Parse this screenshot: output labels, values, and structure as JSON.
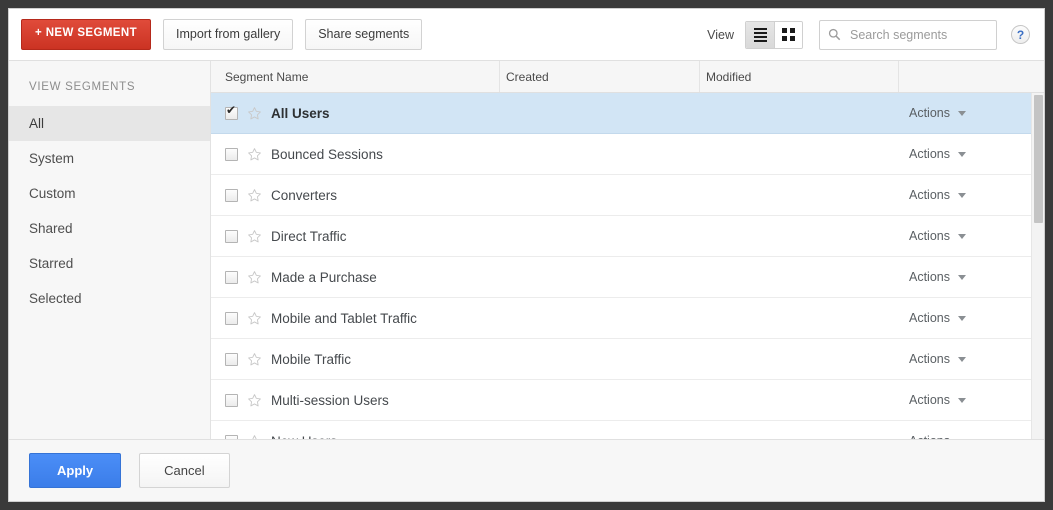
{
  "toolbar": {
    "new_segment_label": "+ NEW SEGMENT",
    "import_label": "Import from gallery",
    "share_label": "Share segments",
    "view_label": "View",
    "list_view_icon": "list-view-icon",
    "grid_view_icon": "grid-view-icon",
    "search_placeholder": "Search segments",
    "search_value": "",
    "search_icon": "search-icon",
    "help_icon": "help-icon",
    "help_glyph": "?"
  },
  "sidebar": {
    "heading": "VIEW SEGMENTS",
    "items": [
      {
        "label": "All",
        "active": true
      },
      {
        "label": "System",
        "active": false
      },
      {
        "label": "Custom",
        "active": false
      },
      {
        "label": "Shared",
        "active": false
      },
      {
        "label": "Starred",
        "active": false
      },
      {
        "label": "Selected",
        "active": false
      }
    ]
  },
  "table": {
    "columns": [
      "Segment Name",
      "Created",
      "Modified",
      ""
    ],
    "action_label": "Actions",
    "rows": [
      {
        "name": "All Users",
        "created": "",
        "modified": "",
        "checked": true,
        "starred": false,
        "selected": true
      },
      {
        "name": "Bounced Sessions",
        "created": "",
        "modified": "",
        "checked": false,
        "starred": false,
        "selected": false
      },
      {
        "name": "Converters",
        "created": "",
        "modified": "",
        "checked": false,
        "starred": false,
        "selected": false
      },
      {
        "name": "Direct Traffic",
        "created": "",
        "modified": "",
        "checked": false,
        "starred": false,
        "selected": false
      },
      {
        "name": "Made a Purchase",
        "created": "",
        "modified": "",
        "checked": false,
        "starred": false,
        "selected": false
      },
      {
        "name": "Mobile and Tablet Traffic",
        "created": "",
        "modified": "",
        "checked": false,
        "starred": false,
        "selected": false
      },
      {
        "name": "Mobile Traffic",
        "created": "",
        "modified": "",
        "checked": false,
        "starred": false,
        "selected": false
      },
      {
        "name": "Multi-session Users",
        "created": "",
        "modified": "",
        "checked": false,
        "starred": false,
        "selected": false
      },
      {
        "name": "New Users",
        "created": "",
        "modified": "",
        "checked": false,
        "starred": false,
        "selected": false
      }
    ]
  },
  "footer": {
    "apply_label": "Apply",
    "cancel_label": "Cancel"
  },
  "colors": {
    "new_segment_red": "#d33b2c",
    "apply_blue": "#4285f4",
    "row_selected_blue": "#d2e5f5",
    "sidebar_bg": "#f7f7f7",
    "help_blue": "#3b6fc4"
  }
}
